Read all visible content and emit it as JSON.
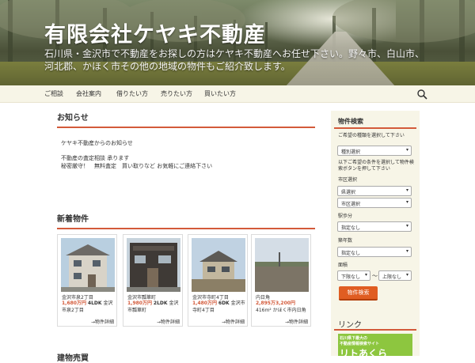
{
  "header": {
    "title": "有限会社ケヤキ不動産",
    "description": "石川県・金沢市で不動産をお探しの方はケヤキ不動産へお任せ下さい。野々市、白山市、河北郡、かほく市その他の地域の物件もご紹介致します。"
  },
  "nav": {
    "items": [
      "ご相談",
      "会社案内",
      "借りたい方",
      "売りたい方",
      "買いたい方"
    ],
    "search_icon": "search-icon"
  },
  "notice": {
    "heading": "お知らせ",
    "line1": "ケヤキ不動産からのお知らせ",
    "line2": "不動産の査定相談 承ります",
    "line3": "秘密厳守！　無料査定　買い取りなど お気軽にご連絡下さい"
  },
  "new_listings": {
    "heading": "新着物件",
    "more_label": "→物件詳細",
    "cards": [
      {
        "address": "金沢市泉2丁目",
        "price": "1,680万円",
        "detail": "4LDK",
        "location": "金沢市泉2丁目"
      },
      {
        "address": "金沢市瓢箪町",
        "price": "1,980万円",
        "detail": "2LDK",
        "location": "金沢市瓢箪町"
      },
      {
        "address": "金沢市寺町4丁目",
        "price": "1,480万円",
        "detail": "6DK",
        "location": "金沢市寺町4丁目"
      },
      {
        "address": "内日角",
        "price": "2,895万3,200円",
        "detail": "416m²",
        "location": "かほく市内日角"
      }
    ]
  },
  "bottom_heading": "建物売買",
  "sidebar": {
    "title": "物件検索",
    "type_label": "ご希望の種類を選択して下さい",
    "type_select": "種別選択",
    "area_note": "以下ご希望の条件を選択して物件検索ボタンを押して下さい",
    "city_label": "市区選択",
    "pref_select": "県選択",
    "city_select": "市区選択",
    "walk_label": "駅歩分",
    "walk_select": "指定なし",
    "age_label": "築年数",
    "age_select": "指定なし",
    "area_label": "面積",
    "area_min": "下限なし",
    "area_sep": "～",
    "area_max": "上限なし",
    "search_button": "物件検索",
    "link_title": "リンク",
    "banner_line1": "石川県下最大の",
    "banner_line2": "不動産情報検索サイト",
    "banner_line3": "リトあくら"
  },
  "colors": {
    "accent": "#d35a3a",
    "button": "#e05d22",
    "nav_bg": "#f7f5e7",
    "banner": "#8dc63f"
  }
}
